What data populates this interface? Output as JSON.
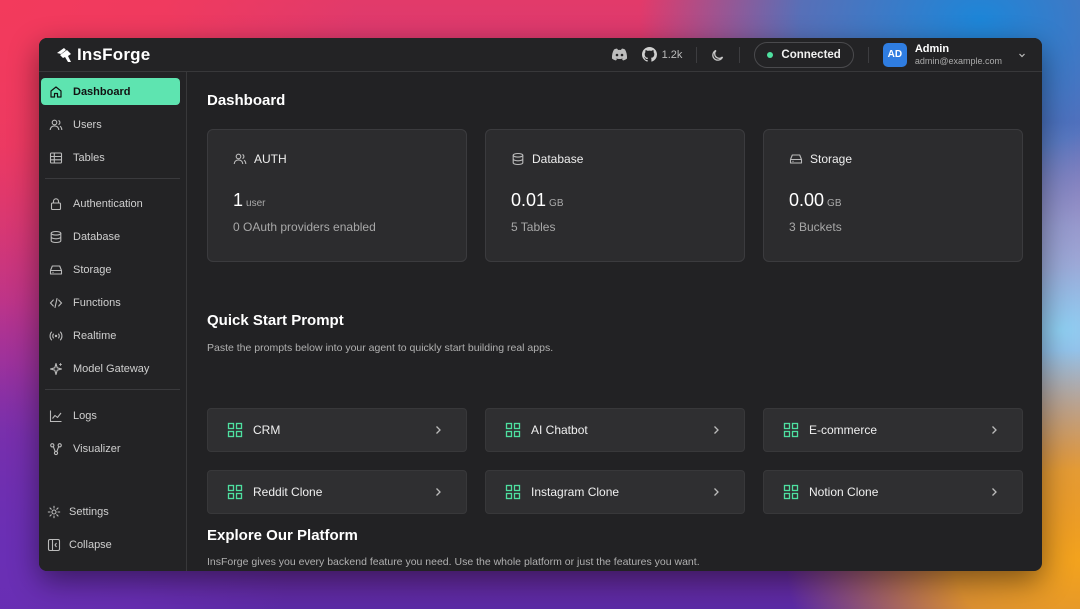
{
  "app": {
    "name": "InsForge"
  },
  "topbar": {
    "github_stars": "1.2k",
    "status": "Connected",
    "status_color": "#4ee0a0",
    "user": {
      "initials": "AD",
      "name": "Admin",
      "email": "admin@example.com"
    }
  },
  "sidebar": {
    "items": [
      {
        "label": "Dashboard",
        "icon": "home-icon",
        "active": true
      },
      {
        "label": "Users",
        "icon": "users-icon"
      },
      {
        "label": "Tables",
        "icon": "table-icon"
      },
      {
        "label": "Authentication",
        "icon": "lock-icon"
      },
      {
        "label": "Database",
        "icon": "database-icon"
      },
      {
        "label": "Storage",
        "icon": "storage-icon"
      },
      {
        "label": "Functions",
        "icon": "code-icon"
      },
      {
        "label": "Realtime",
        "icon": "broadcast-icon"
      },
      {
        "label": "Model Gateway",
        "icon": "sparkles-icon"
      },
      {
        "label": "Logs",
        "icon": "chart-line-icon"
      },
      {
        "label": "Visualizer",
        "icon": "graph-icon"
      }
    ],
    "settings": "Settings",
    "collapse": "Collapse",
    "accent": "#5ee4b0"
  },
  "main": {
    "title": "Dashboard",
    "cards": [
      {
        "label": "AUTH",
        "value": "1",
        "unit": "user",
        "sub": "0 OAuth providers enabled",
        "icon": "users-icon"
      },
      {
        "label": "Database",
        "value": "0.01",
        "unit": "GB",
        "sub": "5 Tables",
        "icon": "database-icon"
      },
      {
        "label": "Storage",
        "value": "0.00",
        "unit": "GB",
        "sub": "3 Buckets",
        "icon": "storage-icon"
      }
    ],
    "quick_start": {
      "title": "Quick Start Prompt",
      "description": "Paste the prompts below into your agent to quickly start building real apps.",
      "prompts": [
        "CRM",
        "AI Chatbot",
        "E-commerce",
        "Reddit Clone",
        "Instagram Clone",
        "Notion Clone"
      ]
    },
    "explore": {
      "title": "Explore Our Platform",
      "description": "InsForge gives you every backend feature you need. Use the whole platform or just the features you want."
    }
  }
}
